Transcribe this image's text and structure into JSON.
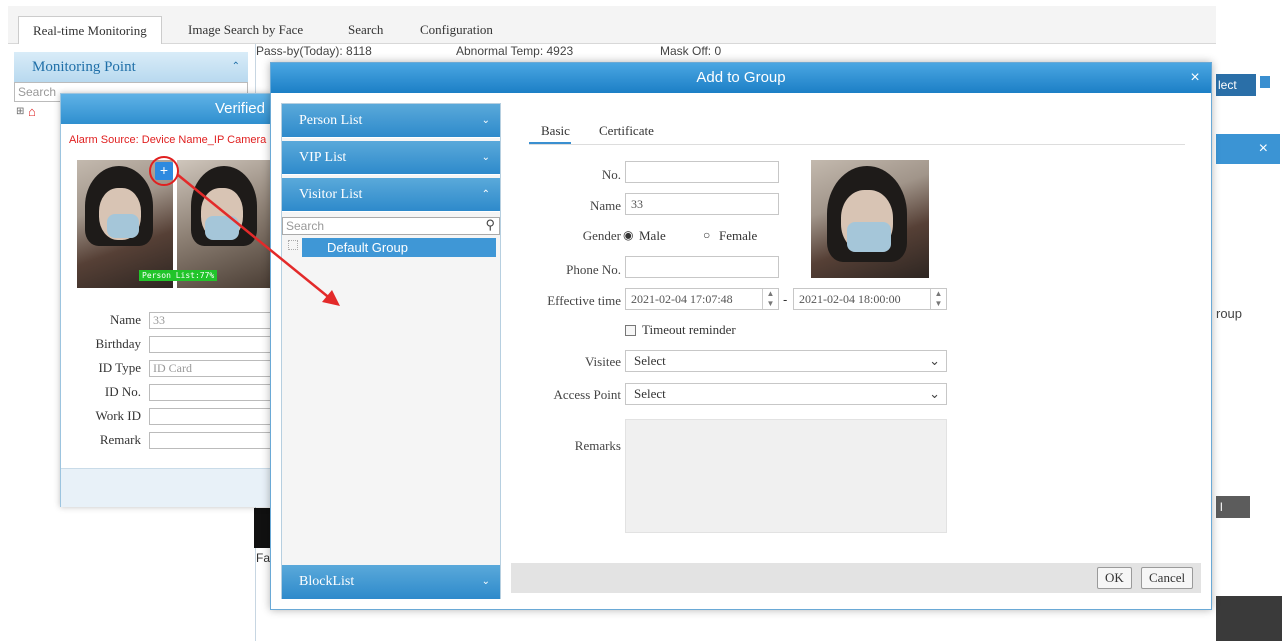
{
  "top_tabs": [
    "Real-time Monitoring",
    "Image Search by Face",
    "Search",
    "Configuration"
  ],
  "left_panel": {
    "title": "Monitoring Point",
    "search_placeholder": "Search"
  },
  "stats": {
    "passby": "Pass-by(Today): 8118",
    "abnormal": "Abnormal Temp: 4923",
    "mask_off": "Mask Off: 0",
    "face_label": "Fa"
  },
  "verified_popup": {
    "title": "Verified",
    "alarm_source": "Alarm Source: Device Name_IP Camera",
    "badge": "Person List:77%",
    "fields": [
      {
        "label": "Name",
        "value": "33"
      },
      {
        "label": "Birthday",
        "value": ""
      },
      {
        "label": "ID Type",
        "value": "ID Card"
      },
      {
        "label": "ID No.",
        "value": ""
      },
      {
        "label": "Work ID",
        "value": ""
      },
      {
        "label": "Remark",
        "value": ""
      }
    ]
  },
  "right_background": {
    "select_label": "lect",
    "group_label": "roup",
    "button_label": "l"
  },
  "modal": {
    "title": "Add to Group",
    "close": "×",
    "lists": {
      "person": "Person List",
      "vip": "VIP List",
      "visitor": "Visitor List",
      "block": "BlockList"
    },
    "search_placeholder": "Search",
    "default_group": "Default Group",
    "tabs": {
      "basic": "Basic",
      "certificate": "Certificate"
    },
    "form": {
      "no_label": "No.",
      "no_value": "",
      "name_label": "Name",
      "name_value": "33",
      "gender_label": "Gender",
      "gender_male": "Male",
      "gender_female": "Female",
      "phone_label": "Phone No.",
      "phone_value": "",
      "effective_label": "Effective time",
      "effective_start": "2021-02-04 17:07:48",
      "effective_sep": "-",
      "effective_end": "2021-02-04 18:00:00",
      "timeout_label": "Timeout reminder",
      "visitee_label": "Visitee",
      "visitee_value": "Select",
      "access_label": "Access Point",
      "access_value": "Select",
      "remarks_label": "Remarks"
    },
    "buttons": {
      "ok": "OK",
      "cancel": "Cancel"
    }
  },
  "colors": {
    "header_blue": "#2f8fcf",
    "accent_red": "#e02020",
    "selected_blue": "#3f97d6"
  }
}
